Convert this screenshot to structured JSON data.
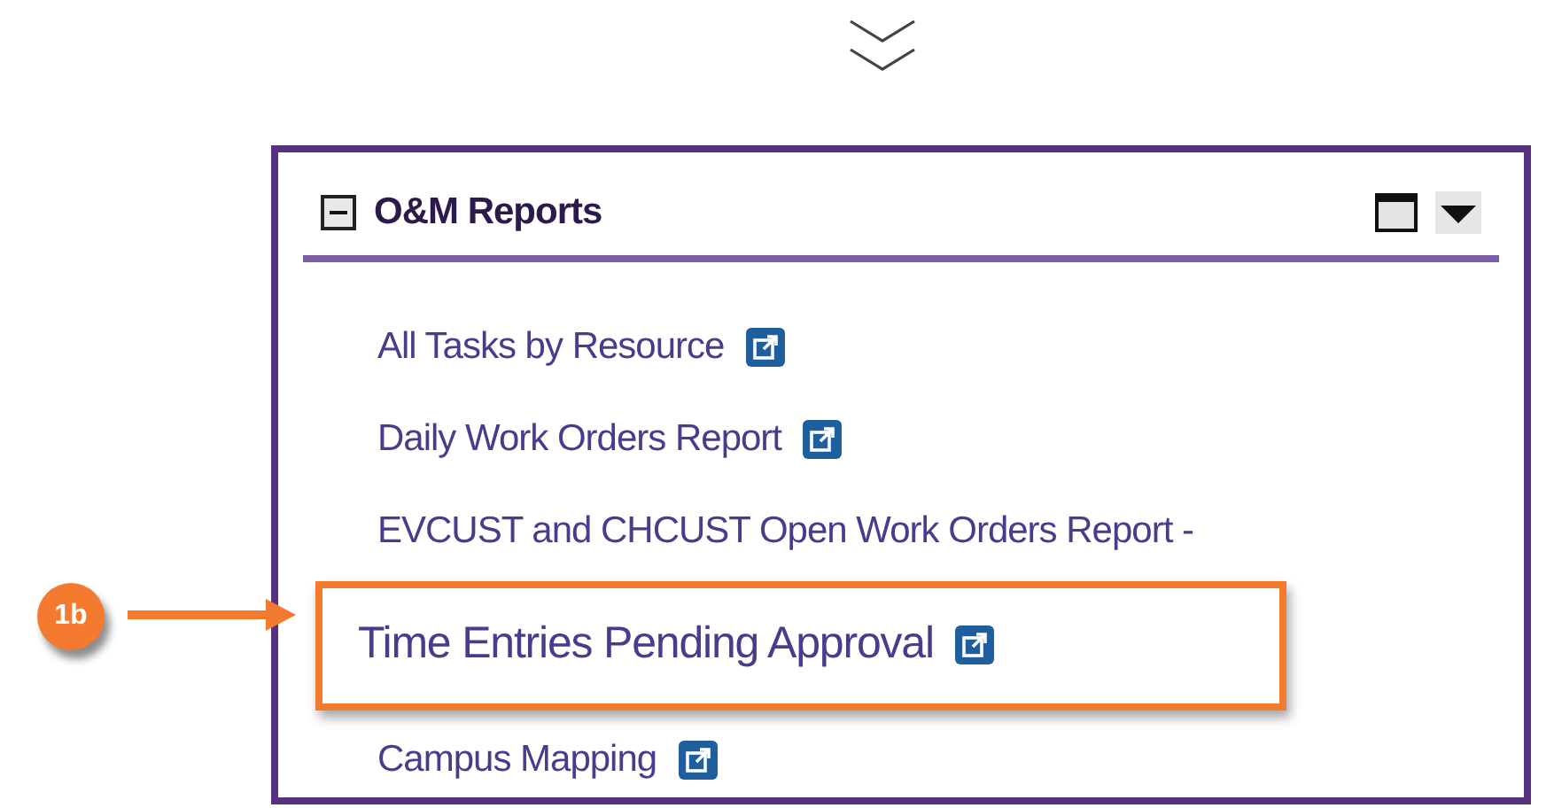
{
  "panel": {
    "title": "O&M Reports",
    "collapsed": false,
    "links": [
      {
        "label": "All Tasks by Resource",
        "external": true,
        "highlighted": false
      },
      {
        "label": "Daily Work Orders Report",
        "external": true,
        "highlighted": false
      },
      {
        "label": "EVCUST and CHCUST Open Work Orders Report -",
        "external": false,
        "highlighted": false
      },
      {
        "label": "Time Entries Pending Approval",
        "external": true,
        "highlighted": true
      },
      {
        "label": "Campus Mapping",
        "external": true,
        "highlighted": false
      }
    ]
  },
  "callout": {
    "label": "1b"
  }
}
